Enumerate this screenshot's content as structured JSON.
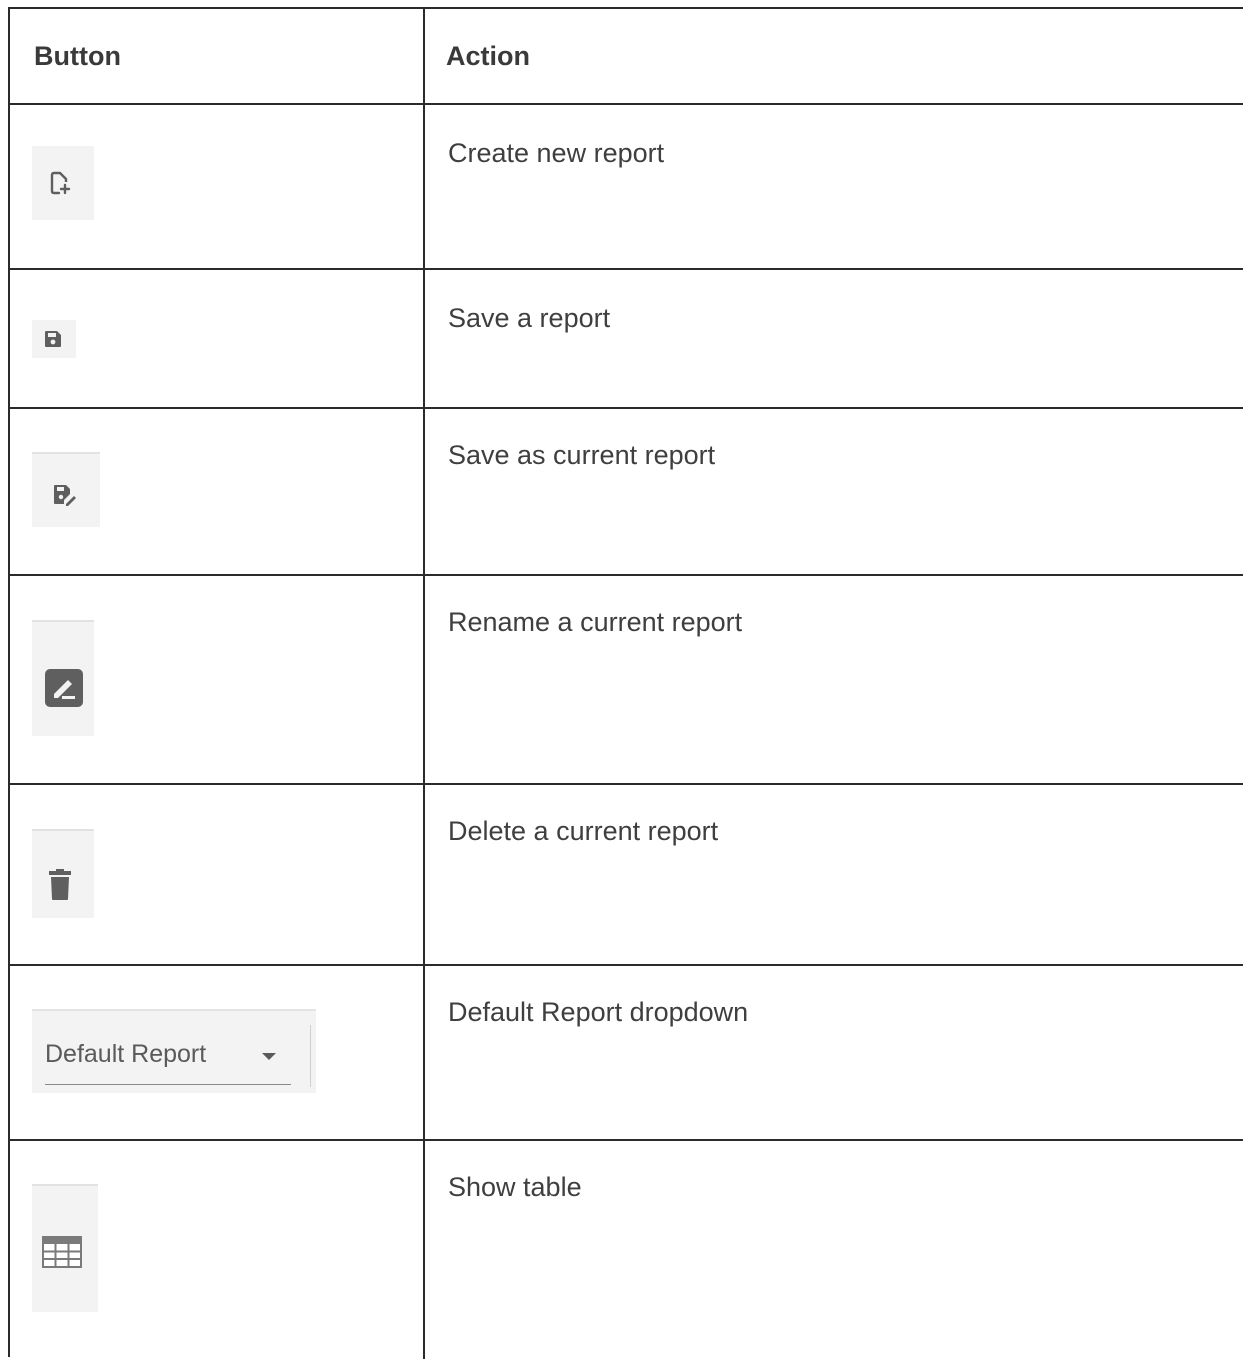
{
  "table": {
    "headers": {
      "button": "Button",
      "action": "Action"
    },
    "rows": [
      {
        "icon": "new-report-icon",
        "action": "Create new report"
      },
      {
        "icon": "save-icon",
        "action": "Save a report"
      },
      {
        "icon": "save-as-icon",
        "action": "Save as current report"
      },
      {
        "icon": "rename-icon",
        "action": "Rename a current report"
      },
      {
        "icon": "trash-icon",
        "action": "Delete a current report"
      },
      {
        "icon": "dropdown",
        "dropdown_label": "Default Report",
        "action": "Default Report dropdown"
      },
      {
        "icon": "table-icon",
        "action": "Show table"
      }
    ]
  },
  "colors": {
    "border": "#2b2b2b",
    "icon_fill": "#5f5f5f",
    "button_bg": "#f3f3f3",
    "text": "#3f3f3f"
  }
}
